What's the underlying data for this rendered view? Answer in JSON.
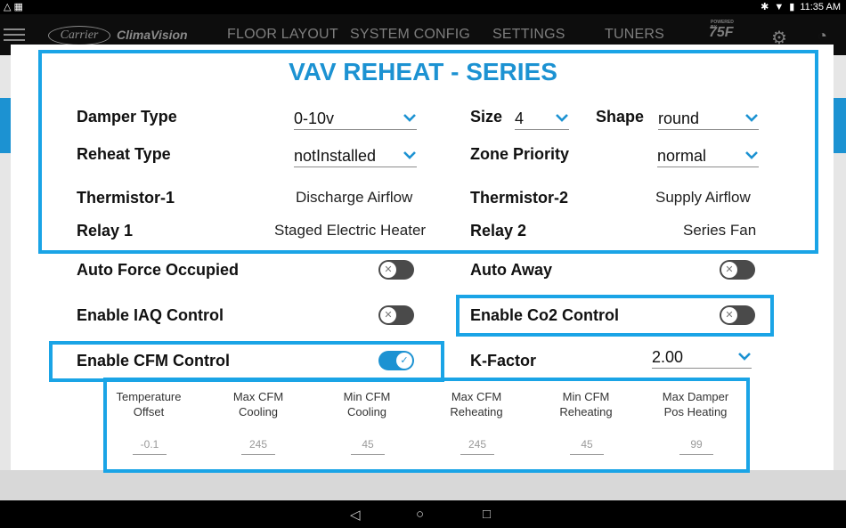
{
  "status": {
    "time": "11:35 AM"
  },
  "appbar": {
    "carrier_logo": "Carrier",
    "app_name": "ClimaVision",
    "tabs": [
      "FLOOR LAYOUT",
      "SYSTEM CONFIG",
      "SETTINGS",
      "TUNERS"
    ],
    "brand_small": "POWERED BY",
    "brand": "75F"
  },
  "icons": {
    "menu": "menu-icon",
    "settings": "gear-icon",
    "dashboard": "gauge-icon",
    "back": "back-icon",
    "home": "home-icon",
    "recents": "recents-icon"
  },
  "colors": {
    "accent": "#1c92d2",
    "highlight": "#1aa4e6",
    "toggle_off": "#4a4a4a"
  },
  "dialog": {
    "title": "VAV REHEAT - SERIES",
    "damper_type": {
      "label": "Damper Type",
      "value": "0-10v"
    },
    "size": {
      "label": "Size",
      "value": "4"
    },
    "shape": {
      "label": "Shape",
      "value": "round"
    },
    "reheat_type": {
      "label": "Reheat Type",
      "value": "notInstalled"
    },
    "zone_priority": {
      "label": "Zone Priority",
      "value": "normal"
    },
    "thermistor1": {
      "label": "Thermistor-1",
      "value": "Discharge Airflow"
    },
    "thermistor2": {
      "label": "Thermistor-2",
      "value": "Supply Airflow"
    },
    "relay1": {
      "label": "Relay 1",
      "value": "Staged Electric Heater"
    },
    "relay2": {
      "label": "Relay 2",
      "value": "Series Fan"
    },
    "auto_force_occupied": {
      "label": "Auto Force Occupied",
      "enabled": false
    },
    "auto_away": {
      "label": "Auto Away",
      "enabled": false
    },
    "enable_iaq": {
      "label": "Enable IAQ Control",
      "enabled": false
    },
    "enable_co2": {
      "label": "Enable Co2 Control",
      "enabled": false
    },
    "enable_cfm": {
      "label": "Enable CFM Control",
      "enabled": true
    },
    "k_factor": {
      "label": "K-Factor",
      "value": "2.00"
    },
    "cfm": [
      {
        "line1": "Temperature",
        "line2": "Offset",
        "value": "-0.1"
      },
      {
        "line1": "Max CFM",
        "line2": "Cooling",
        "value": "245"
      },
      {
        "line1": "Min CFM",
        "line2": "Cooling",
        "value": "45"
      },
      {
        "line1": "Max CFM",
        "line2": "Reheating",
        "value": "245"
      },
      {
        "line1": "Min CFM",
        "line2": "Reheating",
        "value": "45"
      },
      {
        "line1": "Max Damper",
        "line2": "Pos Heating",
        "value": "99"
      }
    ]
  }
}
